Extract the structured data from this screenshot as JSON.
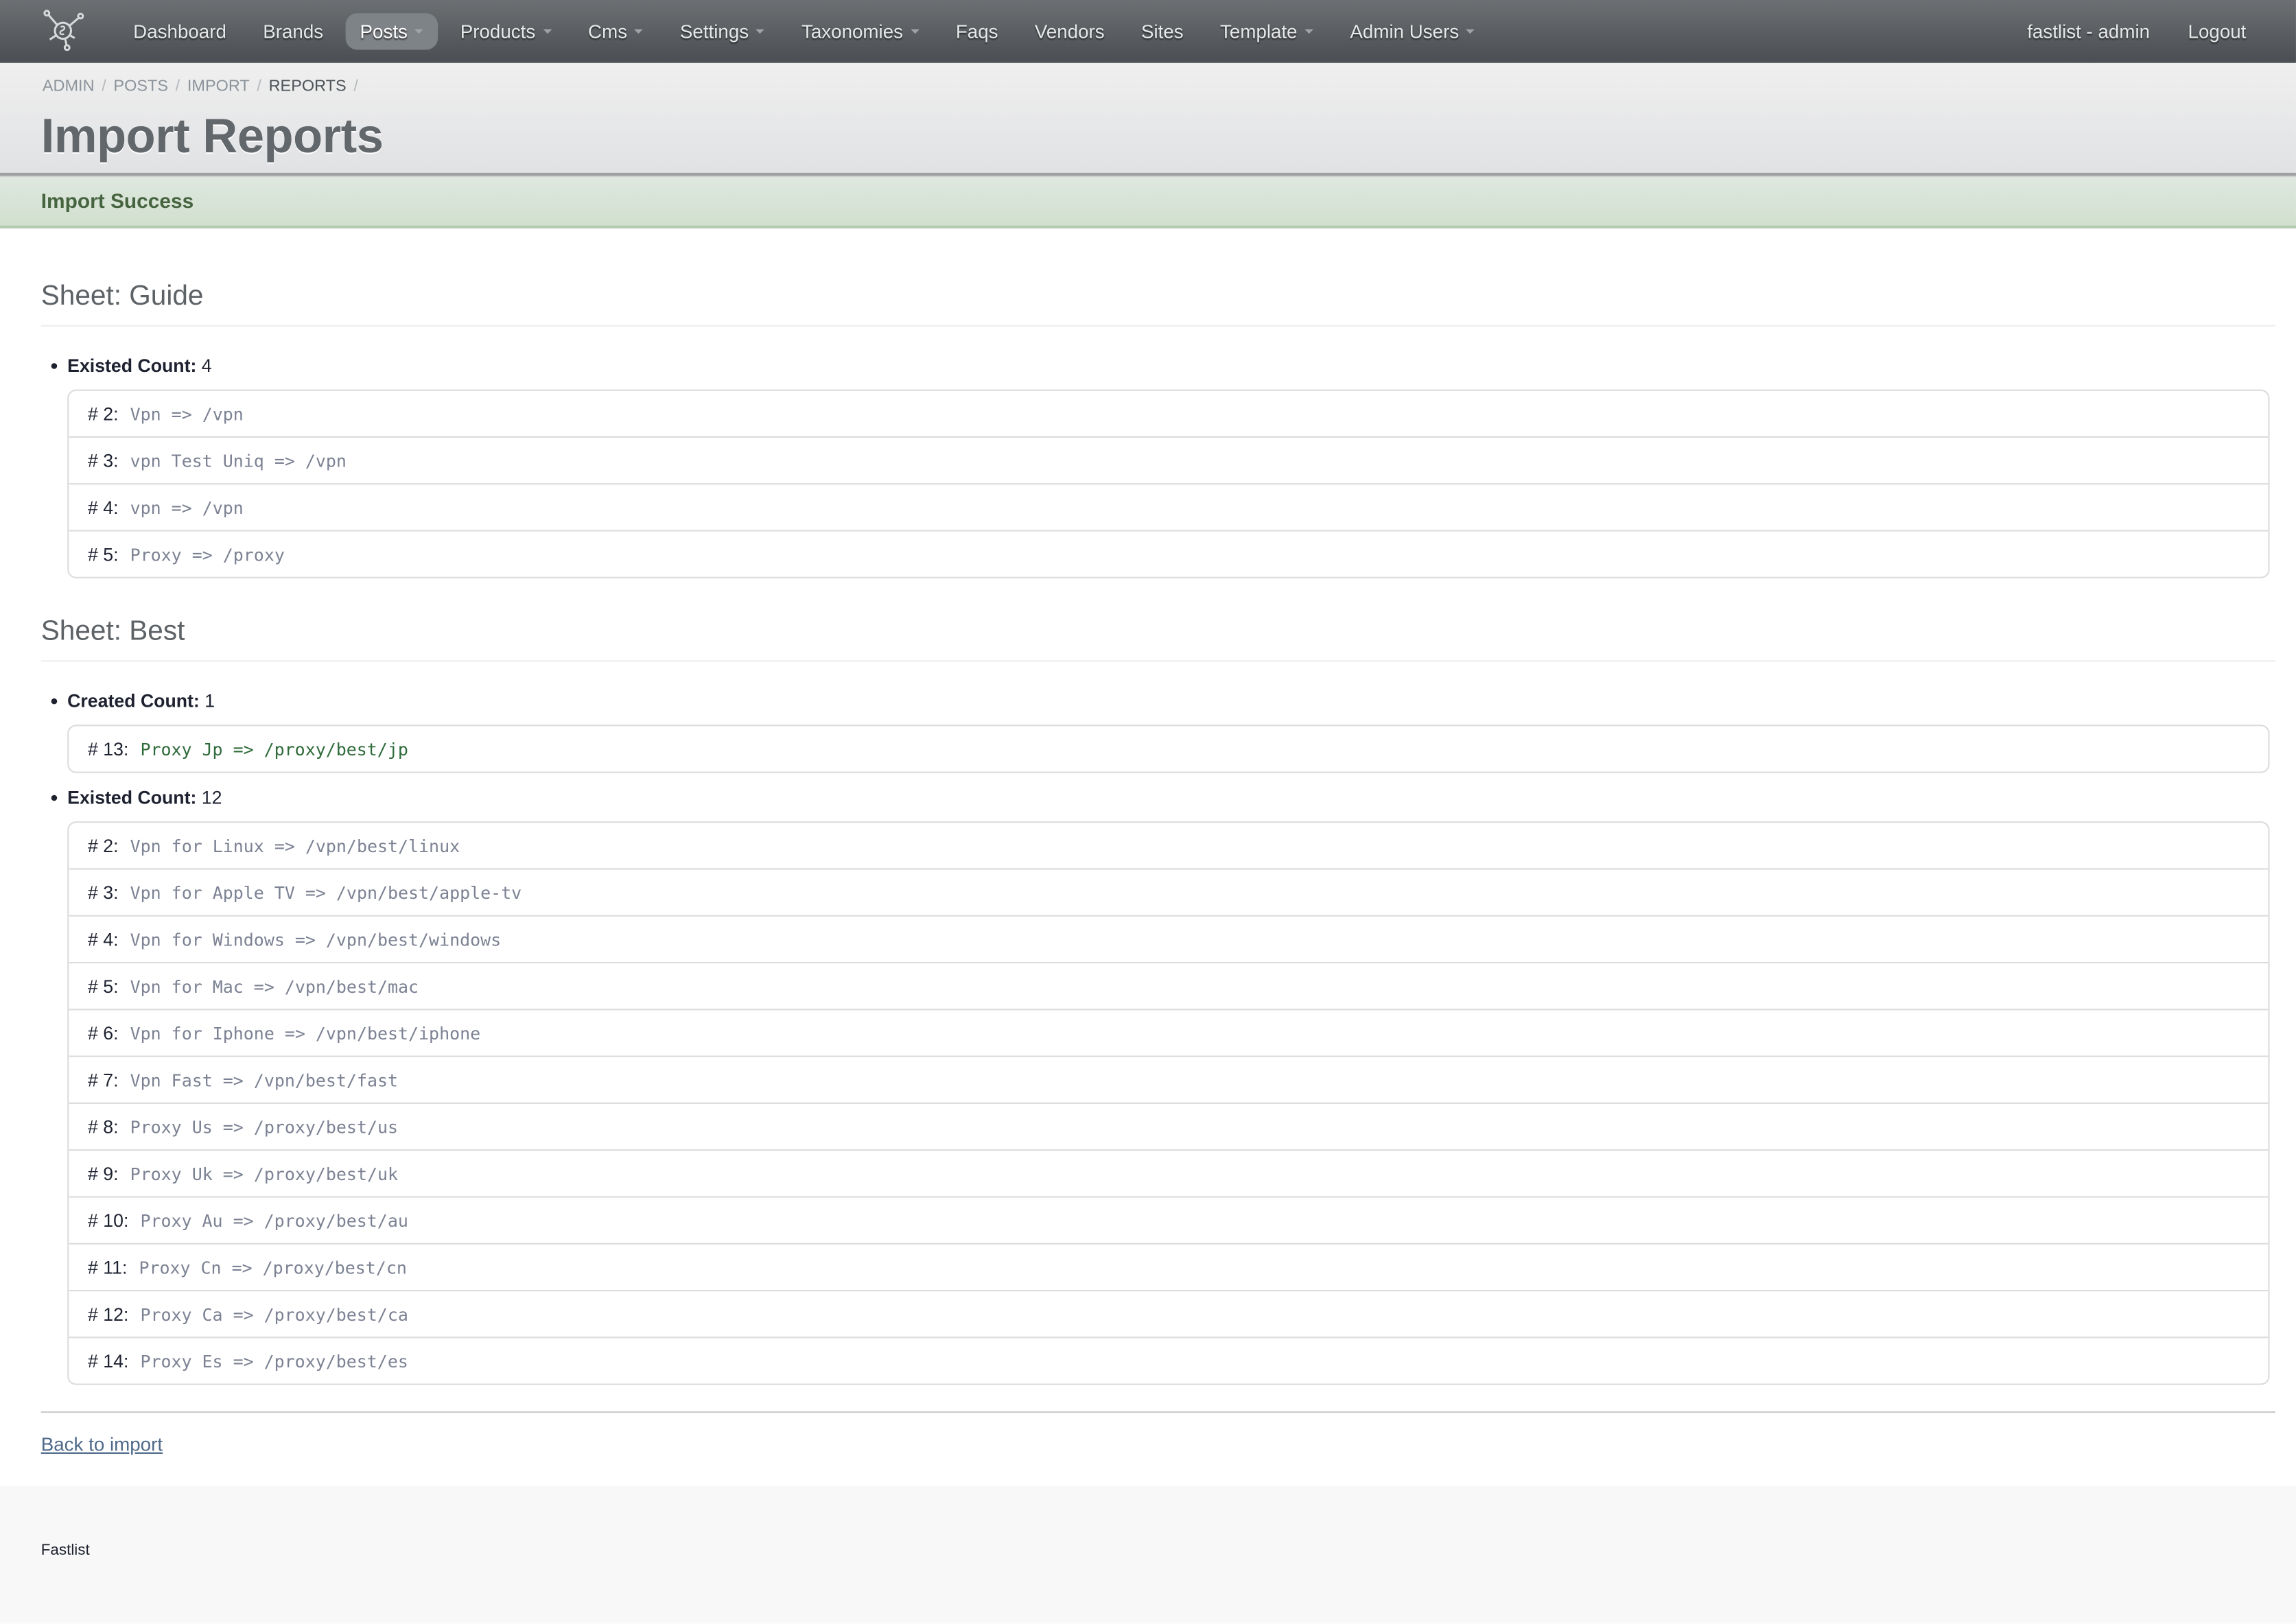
{
  "navbar": {
    "logo_icon": "network-globe-icon",
    "items": [
      {
        "label": "Dashboard",
        "dropdown": false,
        "active": false
      },
      {
        "label": "Brands",
        "dropdown": false,
        "active": false
      },
      {
        "label": "Posts",
        "dropdown": true,
        "active": true
      },
      {
        "label": "Products",
        "dropdown": true,
        "active": false
      },
      {
        "label": "Cms",
        "dropdown": true,
        "active": false
      },
      {
        "label": "Settings",
        "dropdown": true,
        "active": false
      },
      {
        "label": "Taxonomies",
        "dropdown": true,
        "active": false
      },
      {
        "label": "Faqs",
        "dropdown": false,
        "active": false
      },
      {
        "label": "Vendors",
        "dropdown": false,
        "active": false
      },
      {
        "label": "Sites",
        "dropdown": false,
        "active": false
      },
      {
        "label": "Template",
        "dropdown": true,
        "active": false
      },
      {
        "label": "Admin Users",
        "dropdown": true,
        "active": false
      }
    ],
    "user_label": "fastlist - admin",
    "logout_label": "Logout"
  },
  "breadcrumb": {
    "items": [
      "ADMIN",
      "POSTS",
      "IMPORT",
      "REPORTS"
    ],
    "separator": "/"
  },
  "page": {
    "title": "Import Reports"
  },
  "alert": {
    "text": "Import Success",
    "color": "#46643f"
  },
  "sheets": [
    {
      "title": "Sheet: Guide",
      "groups": [
        {
          "label": "Existed Count:",
          "count": "4",
          "type": "existed",
          "rows": [
            {
              "num": "# 2:",
              "text": "Vpn => /vpn"
            },
            {
              "num": "# 3:",
              "text": "vpn Test Uniq => /vpn"
            },
            {
              "num": "# 4:",
              "text": "vpn => /vpn"
            },
            {
              "num": "# 5:",
              "text": "Proxy => /proxy"
            }
          ]
        }
      ]
    },
    {
      "title": "Sheet: Best",
      "groups": [
        {
          "label": "Created Count:",
          "count": "1",
          "type": "created",
          "rows": [
            {
              "num": "# 13:",
              "text": "Proxy Jp => /proxy/best/jp"
            }
          ]
        },
        {
          "label": "Existed Count:",
          "count": "12",
          "type": "existed",
          "rows": [
            {
              "num": "# 2:",
              "text": "Vpn for Linux => /vpn/best/linux"
            },
            {
              "num": "# 3:",
              "text": "Vpn for Apple TV => /vpn/best/apple-tv"
            },
            {
              "num": "# 4:",
              "text": "Vpn for Windows => /vpn/best/windows"
            },
            {
              "num": "# 5:",
              "text": "Vpn for Mac => /vpn/best/mac"
            },
            {
              "num": "# 6:",
              "text": "Vpn for Iphone => /vpn/best/iphone"
            },
            {
              "num": "# 7:",
              "text": "Vpn Fast => /vpn/best/fast"
            },
            {
              "num": "# 8:",
              "text": "Proxy Us => /proxy/best/us"
            },
            {
              "num": "# 9:",
              "text": "Proxy Uk => /proxy/best/uk"
            },
            {
              "num": "# 10:",
              "text": "Proxy Au => /proxy/best/au"
            },
            {
              "num": "# 11:",
              "text": "Proxy Cn => /proxy/best/cn"
            },
            {
              "num": "# 12:",
              "text": "Proxy Ca => /proxy/best/ca"
            },
            {
              "num": "# 14:",
              "text": "Proxy Es => /proxy/best/es"
            }
          ]
        }
      ]
    }
  ],
  "back_link": "Back to import",
  "footer": {
    "text": "Fastlist"
  }
}
